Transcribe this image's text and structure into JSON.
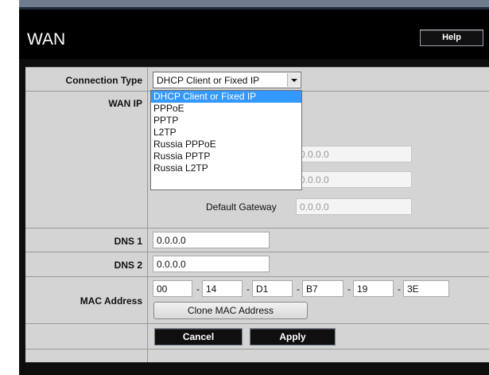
{
  "page": {
    "title": "WAN",
    "help_label": "Help"
  },
  "connection_type": {
    "label": "Connection Type",
    "selected": "DHCP Client or Fixed IP",
    "options": [
      "DHCP Client or Fixed IP",
      "PPPoE",
      "PPTP",
      "L2TP",
      "Russia PPPoE",
      "Russia PPTP",
      "Russia L2TP"
    ]
  },
  "wan_ip": {
    "label": "WAN IP",
    "ip_value": "0.0.0.0",
    "mask_value": "0.0.0.0",
    "gateway_label": "Default Gateway",
    "gateway_value": "0.0.0.0"
  },
  "dns1": {
    "label": "DNS 1",
    "value": "0.0.0.0"
  },
  "dns2": {
    "label": "DNS 2",
    "value": "0.0.0.0"
  },
  "mac": {
    "label": "MAC Address",
    "octets": [
      "00",
      "14",
      "D1",
      "B7",
      "19",
      "3E"
    ],
    "separator": "-",
    "clone_label": "Clone MAC Address"
  },
  "actions": {
    "cancel_label": "Cancel",
    "apply_label": "Apply"
  },
  "colors": {
    "title_bar": "#000000",
    "form_bg": "#d4d4d4",
    "selected_option": "#3399ff"
  }
}
